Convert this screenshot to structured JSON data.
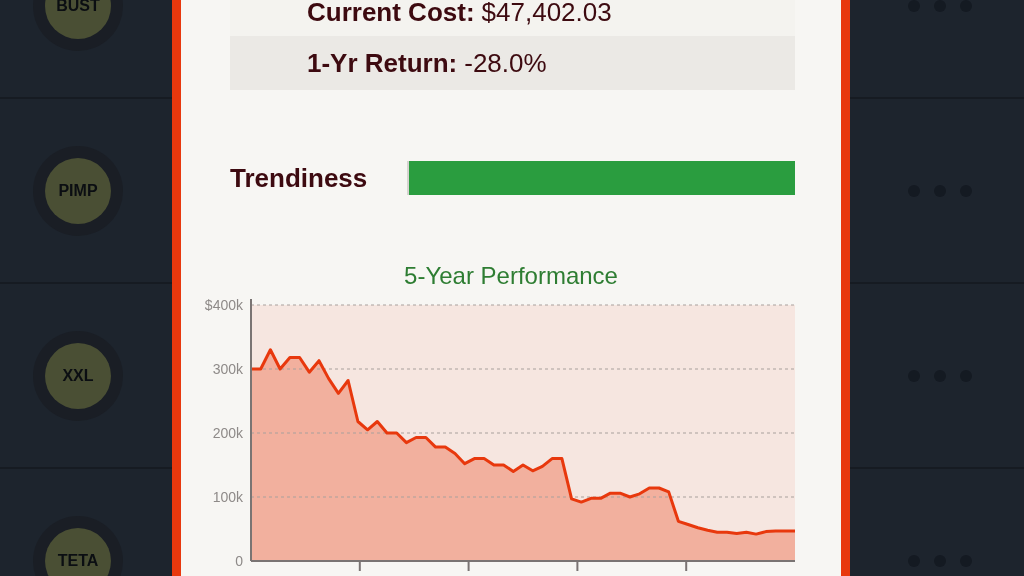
{
  "background_list": {
    "rows": [
      {
        "badge": "BUST"
      },
      {
        "badge": "PIMP"
      },
      {
        "badge": "XXL"
      },
      {
        "badge": "TETA"
      }
    ]
  },
  "details": {
    "stats": [
      {
        "label": "Current Cost:",
        "value": "$47,402.03"
      },
      {
        "label": "1-Yr Return:",
        "value": "-28.0%"
      }
    ],
    "trendiness": {
      "label": "Trendiness",
      "level": 1.0
    },
    "performance": {
      "chart_data": {
        "type": "area",
        "title": "5-Year Performance",
        "categories": [
          null,
          null,
          null,
          null,
          null,
          null,
          null,
          null,
          null,
          null,
          null,
          null,
          null,
          null,
          null,
          null,
          null,
          null,
          null,
          null,
          null,
          null,
          null,
          null,
          null,
          null,
          null,
          null,
          null,
          null,
          null,
          null,
          null,
          null,
          null,
          null,
          null,
          null,
          null,
          null,
          null,
          null,
          null,
          null,
          null,
          null,
          null,
          null,
          null,
          null,
          null,
          null,
          null,
          null,
          null,
          null,
          null
        ],
        "series": [
          {
            "color": "#e8380d",
            "values": [
              300,
              300,
              330,
              300,
              318,
              318,
              295,
              313,
              285,
              262,
              282,
              218,
              205,
              218,
              200,
              200,
              185,
              193,
              193,
              178,
              178,
              168,
              152,
              160,
              160,
              150,
              150,
              140,
              150,
              141,
              148,
              160,
              160,
              97,
              92,
              98,
              98,
              106,
              106,
              100,
              105,
              114,
              114,
              108,
              62,
              57,
              52,
              48,
              45,
              45,
              43,
              45,
              42,
              46,
              47,
              47,
              47
            ]
          }
        ],
        "ylim": [
          0,
          400
        ],
        "grid": true,
        "yticks": [
          {
            "value": 0,
            "label": "0"
          },
          {
            "value": 100,
            "label": "100k"
          },
          {
            "value": 200,
            "label": "200k"
          },
          {
            "value": 300,
            "label": "300k"
          },
          {
            "value": 400,
            "label": "$400k"
          }
        ]
      }
    }
  }
}
